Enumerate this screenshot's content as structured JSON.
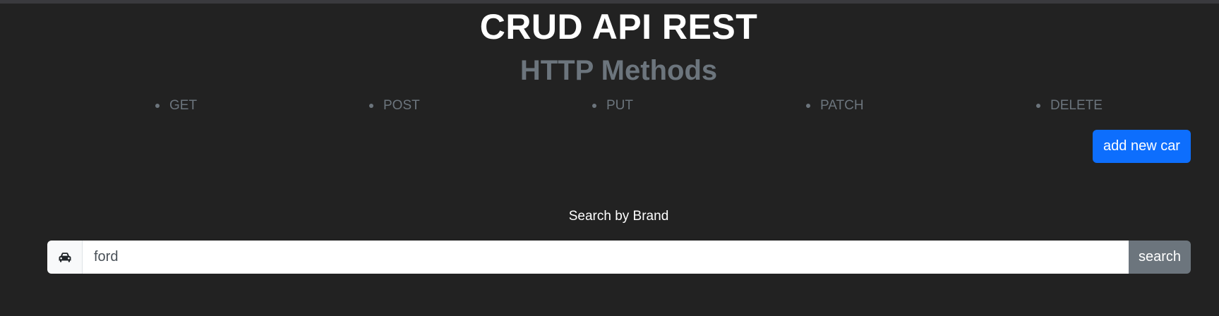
{
  "header": {
    "title": "CRUD API REST",
    "subtitle": "HTTP Methods"
  },
  "methods": [
    "GET",
    "POST",
    "PUT",
    "PATCH",
    "DELETE"
  ],
  "actions": {
    "add_label": "add new car"
  },
  "search": {
    "label": "Search by Brand",
    "value": "ford",
    "placeholder": "",
    "button_label": "search",
    "addon_icon": "car-icon"
  },
  "colors": {
    "background": "#222222",
    "primary": "#0d6efd",
    "secondary": "#6c757d",
    "text": "#ffffff"
  }
}
